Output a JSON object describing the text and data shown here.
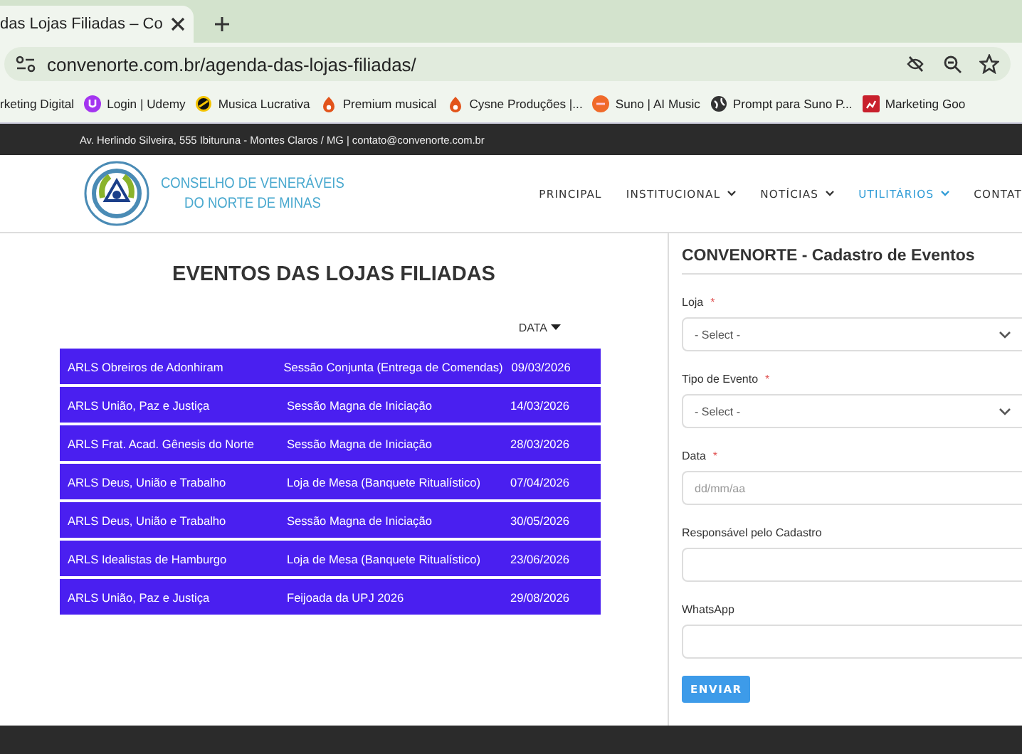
{
  "browser": {
    "tab_title": "das Lojas Filiadas – Co",
    "url": "convenorte.com.br/agenda-das-lojas-filiadas/",
    "bookmarks": [
      {
        "label": "rketing Digital",
        "kind": "none"
      },
      {
        "label": "Login | Udemy",
        "kind": "purple-circle"
      },
      {
        "label": "Musica Lucrativa",
        "kind": "ring"
      },
      {
        "label": "Premium musical",
        "kind": "flame"
      },
      {
        "label": "Cysne Produções |...",
        "kind": "flame"
      },
      {
        "label": "Suno | AI Music",
        "kind": "orange-circle"
      },
      {
        "label": "Prompt para Suno P...",
        "kind": "globe"
      },
      {
        "label": "Marketing Goo",
        "kind": "square"
      }
    ]
  },
  "top_bar": {
    "text": "Av. Herlindo Silveira, 555 Ibituruna - Montes Claros / MG | contato@convenorte.com.br"
  },
  "header": {
    "logo_line_1": "CONSELHO DE VENERÁVEIS",
    "logo_line_2": "DO NORTE DE MINAS",
    "nav": [
      {
        "label": "PRINCIPAL",
        "dropdown": false,
        "selected": false
      },
      {
        "label": "INSTITUCIONAL",
        "dropdown": true,
        "selected": false
      },
      {
        "label": "NOTÍCIAS",
        "dropdown": true,
        "selected": false
      },
      {
        "label": "UTILITÁRIOS",
        "dropdown": true,
        "selected": true
      },
      {
        "label": "CONTAT",
        "dropdown": false,
        "selected": false
      }
    ]
  },
  "events": {
    "title": "EVENTOS DAS LOJAS FILIADAS",
    "sort_column": "DATA",
    "rows": [
      [
        "ARLS Obreiros de Adonhiram",
        "Sessão Conjunta (Entrega de Comendas)",
        "09/03/2026"
      ],
      [
        "ARLS União, Paz e Justiça",
        "Sessão Magna de Iniciação",
        "14/03/2026"
      ],
      [
        "ARLS Frat. Acad. Gênesis do Norte",
        "Sessão Magna de Iniciação",
        "28/03/2026"
      ],
      [
        "ARLS Deus, União e Trabalho",
        "Loja de Mesa (Banquete Ritualístico)",
        "07/04/2026"
      ],
      [
        "ARLS Deus, União e Trabalho",
        "Sessão Magna de Iniciação",
        "30/05/2026"
      ],
      [
        "ARLS Idealistas de Hamburgo",
        "Loja de Mesa (Banquete Ritualístico)",
        "23/06/2026"
      ],
      [
        "ARLS União, Paz e Justiça",
        "Feijoada da UPJ 2026",
        "29/08/2026"
      ]
    ]
  },
  "form": {
    "title": "CONVENORTE - Cadastro de Eventos",
    "fields": [
      {
        "label": "Loja",
        "required": true,
        "kind": "select",
        "value": "- Select -"
      },
      {
        "label": "Tipo de Evento",
        "required": true,
        "kind": "select",
        "value": "- Select -"
      },
      {
        "label": "Data",
        "required": true,
        "kind": "text",
        "placeholder": "dd/mm/aa"
      },
      {
        "label": "Responsável pelo Cadastro",
        "required": false,
        "kind": "text"
      },
      {
        "label": "WhatsApp",
        "required": false,
        "kind": "text"
      }
    ],
    "required_mark": "*",
    "submit": "ENVIAR"
  }
}
